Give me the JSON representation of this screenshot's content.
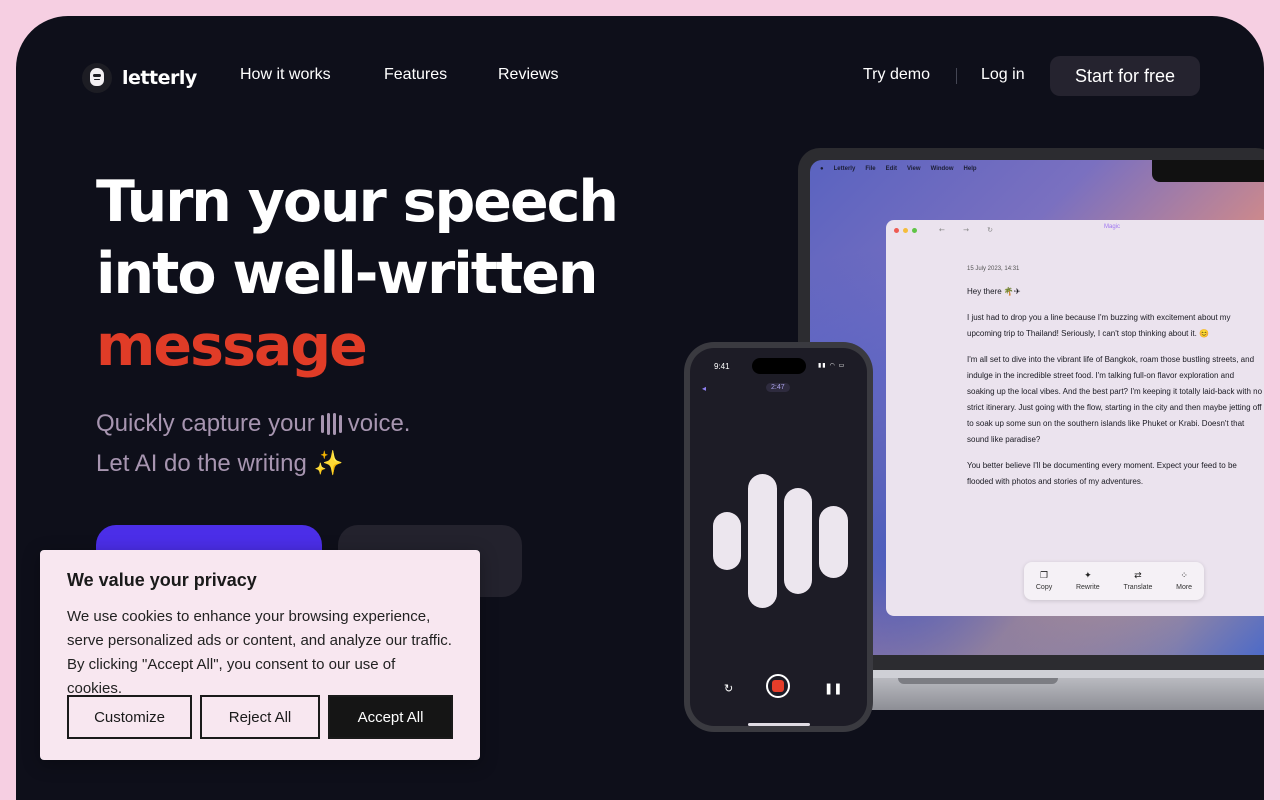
{
  "nav": {
    "brand": "letterly",
    "links": [
      "How it works",
      "Features",
      "Reviews"
    ],
    "try_demo": "Try demo",
    "login": "Log in",
    "start": "Start for free"
  },
  "hero": {
    "line1": "Turn your speech",
    "line2": "into well-written",
    "line3": "message",
    "sub1_before": "Quickly capture your",
    "sub1_after": "voice.",
    "sub2": "Let AI do the writing ✨",
    "accent_color": "#e03c27"
  },
  "laptop": {
    "menu": [
      "Letterly",
      "File",
      "Edit",
      "View",
      "Window",
      "Help"
    ],
    "window_title": "Magic",
    "date": "15 July 2023, 14:31",
    "greeting": "Hey there 🌴✈",
    "para1": "I just had to drop you a line because I'm buzzing with excitement about my upcoming trip to Thailand! Seriously, I can't stop thinking about it. 😊",
    "para2": "I'm all set to dive into the vibrant life of Bangkok, roam those bustling streets, and indulge in the incredible street food. I'm talking full-on flavor exploration and soaking up the local vibes. And the best part? I'm keeping it totally laid-back with no strict itinerary. Just going with the flow, starting in the city and then maybe jetting off to soak up some sun on the southern islands like Phuket or Krabi. Doesn't that sound like paradise?",
    "para3": "You better believe I'll be documenting every moment. Expect your feed to be flooded with photos and stories of my adventures.",
    "tools": [
      "Copy",
      "Rewrite",
      "Translate",
      "More"
    ]
  },
  "phone": {
    "time": "9:41",
    "timer": "2:47"
  },
  "cookie": {
    "title": "We value your privacy",
    "text": "We use cookies to enhance your browsing experience, serve personalized ads or content, and analyze our traffic. By clicking \"Accept All\", you consent to our use of cookies.",
    "customize": "Customize",
    "reject": "Reject All",
    "accept": "Accept All"
  }
}
